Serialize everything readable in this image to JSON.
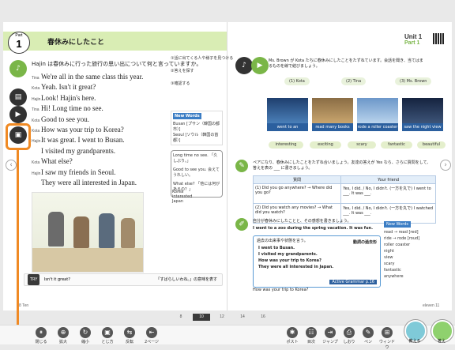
{
  "left_page": {
    "part_label": "Part",
    "part_number": "1",
    "title": "春休みにしたこと",
    "question": "Hajin は春休みに行った旅行の思い出について何と言っていますか。",
    "dialogue": [
      {
        "speaker": "Tina",
        "text": "We're all in the same class this year."
      },
      {
        "speaker": "Kota",
        "text": "Yeah.  Isn't it great?"
      },
      {
        "speaker": "Hajin",
        "text": "Look!  Hajin's here."
      },
      {
        "speaker": "Tina",
        "text": "Hi!  Long time no see."
      },
      {
        "speaker": "Kota",
        "text": "Good to see you."
      },
      {
        "speaker": "Kota",
        "text": "How was your trip to Korea?"
      },
      {
        "speaker": "Hajin",
        "text": "It was great.  I went to Busan."
      },
      {
        "speaker": "",
        "text": "I visited my grandparents."
      },
      {
        "speaker": "Kota",
        "text": "What else?"
      },
      {
        "speaker": "Hajin",
        "text": "I saw my friends in Seoul."
      },
      {
        "speaker": "",
        "text": "They were all interested in Japan."
      }
    ],
    "tips": [
      "①話に出てくる人や様子を見つける",
      "②答えを探す",
      "③確認する"
    ],
    "new_words_label": "New Words",
    "new_words": [
      "Busan [プサン（韓国の都市）]",
      "Seoul [ソウル（韓国の首都）]"
    ],
    "bubble": [
      "Long time no see. 「久しぶり。」",
      "Good to see you. 会えてうれしい。",
      "What else? 「他には何があるの？」"
    ],
    "side_list": [
      "Korea",
      "interested",
      "Japan"
    ],
    "bottom_prompt": "Isn't it great?",
    "bottom_note": "「すばらしいわね。」の意味を表す",
    "page_num": "8",
    "page_label_left": "Ten"
  },
  "right_page": {
    "unit": "Unit 1",
    "part": "Part 1",
    "instruction": "Ms. Brown が Kota たちに春休みにしたことをたずねています。会話を聞き、当てはまるものを線で結びましょう。",
    "people": [
      "(1) Kota",
      "(2) Tina",
      "(3) Ms. Brown"
    ],
    "photos": [
      {
        "tag": "A",
        "label": "went to an aquarium"
      },
      {
        "tag": "B",
        "label": "read many books"
      },
      {
        "tag": "C",
        "label": "rode a roller coaster"
      },
      {
        "tag": "D",
        "label": "saw the night view"
      }
    ],
    "adjectives": [
      "interesting",
      "exciting",
      "scary",
      "fantastic",
      "beautiful"
    ],
    "speak_instruction": "ペアになり、春休みにしたことをたずね合いましょう。友達の答えが Yes なら、さらに質問をして、答えを表の ___ に書きましょう。",
    "table_headers": [
      "質問",
      "Your friend"
    ],
    "table_rows": [
      {
        "q": "(1) Did you go anywhere?  → Where did you go?",
        "a": "Yes, I did. / No, I didn't. (一方を丸で)  I went to ___. It was ___."
      },
      {
        "q": "(2) Did you watch any movies?  → What did you watch?",
        "a": "Yes, I did. / No, I didn't. (一方を丸で)  I watched ___. It was ___."
      }
    ],
    "write_instruction": "自分が春休みにしたことと、その感想を書きましょう。",
    "write_example": "I went to a zoo during the spring vacation. It was fun.",
    "grammar_title": "過去の出来事や状態を言う。",
    "grammar_lines": [
      "I went to Busan.",
      "I visited my grandparents.",
      "How was your trip to Korea?",
      "They were all interested in Japan."
    ],
    "grammar_note": "動詞の過去形",
    "grammar_link": "Active Grammar p.16",
    "bottom_q": "How was your trip to Korea?",
    "new_words_label": "New Words",
    "new_words_right": [
      "read → read [red]",
      "ride → rode [roud]",
      "roller coaster",
      "night",
      "view",
      "scary",
      "fantastic",
      "anywhere"
    ],
    "page_num": "11",
    "page_label_right": "eleven"
  },
  "page_tabs": [
    "8",
    "10",
    "12",
    "14",
    "16"
  ],
  "current_tab": "10",
  "toolbar": {
    "left": [
      "閉じる",
      "拡大",
      "縮小",
      "とじ方",
      "反転",
      "2ページ"
    ],
    "right": [
      "ポスト",
      "目次",
      "ジャンプ",
      "しおり",
      "ペン",
      "ウィンドウ"
    ],
    "green_btn_label": "教える",
    "check_btn_label": "答え"
  },
  "colors": {
    "accent_green": "#7ab648",
    "header_green": "#d9edb4",
    "orange": "#f08a24",
    "blue": "#2b5f9e"
  }
}
